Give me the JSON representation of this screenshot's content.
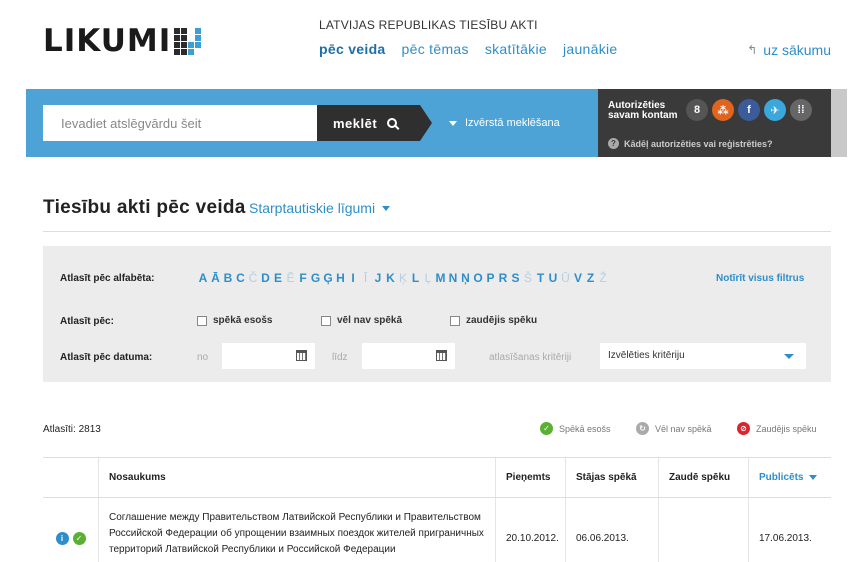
{
  "header": {
    "logo_text": "LIKUMI",
    "top_label": "LATVIJAS REPUBLIKAS TIESĪBU AKTI",
    "nav": [
      "pēc veida",
      "pēc tēmas",
      "skatītākie",
      "jaunākie"
    ],
    "home_link": "uz sākumu"
  },
  "search": {
    "placeholder": "Ievadiet atslēgvārdu šeit",
    "button_label": "meklēt",
    "advanced_label": "Izvērstā meklēšana"
  },
  "auth": {
    "title": "Autorizēties savam kontam",
    "why_label": "Kādēļ autorizēties vai reģistrēties?",
    "social": [
      "g",
      "d",
      "f",
      "t",
      "m"
    ]
  },
  "page": {
    "title": "Tiesību akti pēc veida",
    "type_selected": "Starptautiskie līgumi"
  },
  "filters": {
    "alpha_label": "Atlasīt pēc alfabēta:",
    "letters": [
      {
        "l": "A",
        "active": true
      },
      {
        "l": "Ā",
        "active": true
      },
      {
        "l": "B",
        "active": true
      },
      {
        "l": "C",
        "active": true
      },
      {
        "l": "Č",
        "active": false
      },
      {
        "l": "D",
        "active": true
      },
      {
        "l": "E",
        "active": true
      },
      {
        "l": "Ē",
        "active": false
      },
      {
        "l": "F",
        "active": true
      },
      {
        "l": "G",
        "active": true
      },
      {
        "l": "Ģ",
        "active": true
      },
      {
        "l": "H",
        "active": true
      },
      {
        "l": "I",
        "active": true
      },
      {
        "l": "Ī",
        "active": false
      },
      {
        "l": "J",
        "active": true
      },
      {
        "l": "K",
        "active": true
      },
      {
        "l": "Ķ",
        "active": false
      },
      {
        "l": "L",
        "active": true
      },
      {
        "l": "Ļ",
        "active": false
      },
      {
        "l": "M",
        "active": true
      },
      {
        "l": "N",
        "active": true
      },
      {
        "l": "Ņ",
        "active": true
      },
      {
        "l": "O",
        "active": true
      },
      {
        "l": "P",
        "active": true
      },
      {
        "l": "R",
        "active": true
      },
      {
        "l": "S",
        "active": true
      },
      {
        "l": "Š",
        "active": false
      },
      {
        "l": "T",
        "active": true
      },
      {
        "l": "U",
        "active": true
      },
      {
        "l": "Ū",
        "active": false
      },
      {
        "l": "V",
        "active": true
      },
      {
        "l": "Z",
        "active": true
      },
      {
        "l": "Ž",
        "active": false
      }
    ],
    "clear_label": "Notīrīt visus filtrus",
    "status_label": "Atlasīt pēc:",
    "statuses": [
      "spēkā esošs",
      "vēl nav spēkā",
      "zaudējis spēku"
    ],
    "date_label": "Atlasīt pēc datuma:",
    "from_label": "no",
    "to_label": "līdz",
    "criteria_label": "atlasīšanas kritēriji",
    "criteria_selected": "Izvēlēties kritēriju"
  },
  "results": {
    "count_label": "Atlasīti: 2813",
    "legend": [
      "Spēkā esošs",
      "Vēl nav spēkā",
      "Zaudējis spēku"
    ],
    "columns": [
      "Nosaukums",
      "Pieņemts",
      "Stājas spēkā",
      "Zaudē spēku",
      "Publicēts"
    ],
    "rows": [
      {
        "name": "Соглашение между Правительством Латвийской Республики и Правительством Российской Федерации об упрощении взаимных поездок жителей приграничных территорий Латвийской Республики и Российской Федерации",
        "adopted": "20.10.2012.",
        "in_force": "06.06.2013.",
        "expires": "",
        "published": "17.06.2013."
      }
    ]
  },
  "colors": {
    "accent": "#2e8ec9",
    "band": "#4da3d6",
    "dark": "#2f2f2f",
    "green": "#5ab030",
    "red": "#d9262c"
  }
}
